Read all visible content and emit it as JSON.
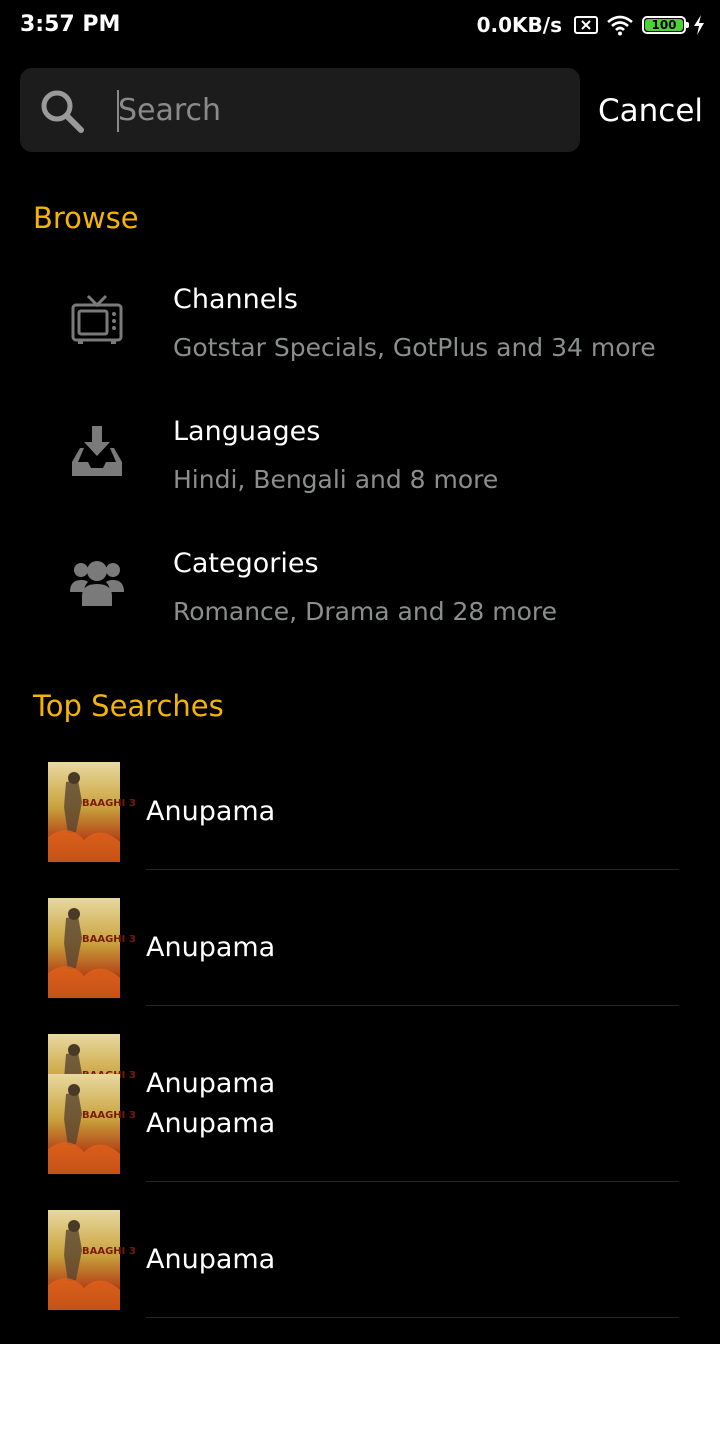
{
  "status_bar": {
    "time": "3:57 PM",
    "network_speed": "0.0KB/s",
    "battery_level": "100",
    "icons": [
      "sim-x-icon",
      "wifi-icon",
      "battery-icon",
      "charging-icon"
    ]
  },
  "search": {
    "placeholder": "Search",
    "cancel_label": "Cancel"
  },
  "browse": {
    "title": "Browse",
    "items": [
      {
        "label": "Channels",
        "subtitle": "Gotstar Specials, GotPlus and 34 more",
        "icon": "tv-icon"
      },
      {
        "label": "Languages",
        "subtitle": "Hindi, Bengali and 8 more",
        "icon": "inbox-download-icon"
      },
      {
        "label": "Categories",
        "subtitle": "Romance, Drama and 28 more",
        "icon": "users-icon"
      }
    ]
  },
  "top_searches": {
    "title": "Top Searches",
    "items": [
      {
        "title": "Anupama",
        "thumb_text": "BAAGHI 3"
      },
      {
        "title": "Anupama",
        "thumb_text": "BAAGHI 3"
      },
      {
        "title": "Anupama",
        "thumb_text": "BAAGHI 3"
      },
      {
        "title": "Anupama",
        "thumb_text": "BAAGHI 3"
      },
      {
        "title": "Anupama",
        "thumb_text": "BAAGHI 3"
      }
    ]
  },
  "colors": {
    "accent": "#f4b400",
    "background": "#000000",
    "subtitle": "#8a8f8e",
    "search_field": "#1c1c1c"
  }
}
